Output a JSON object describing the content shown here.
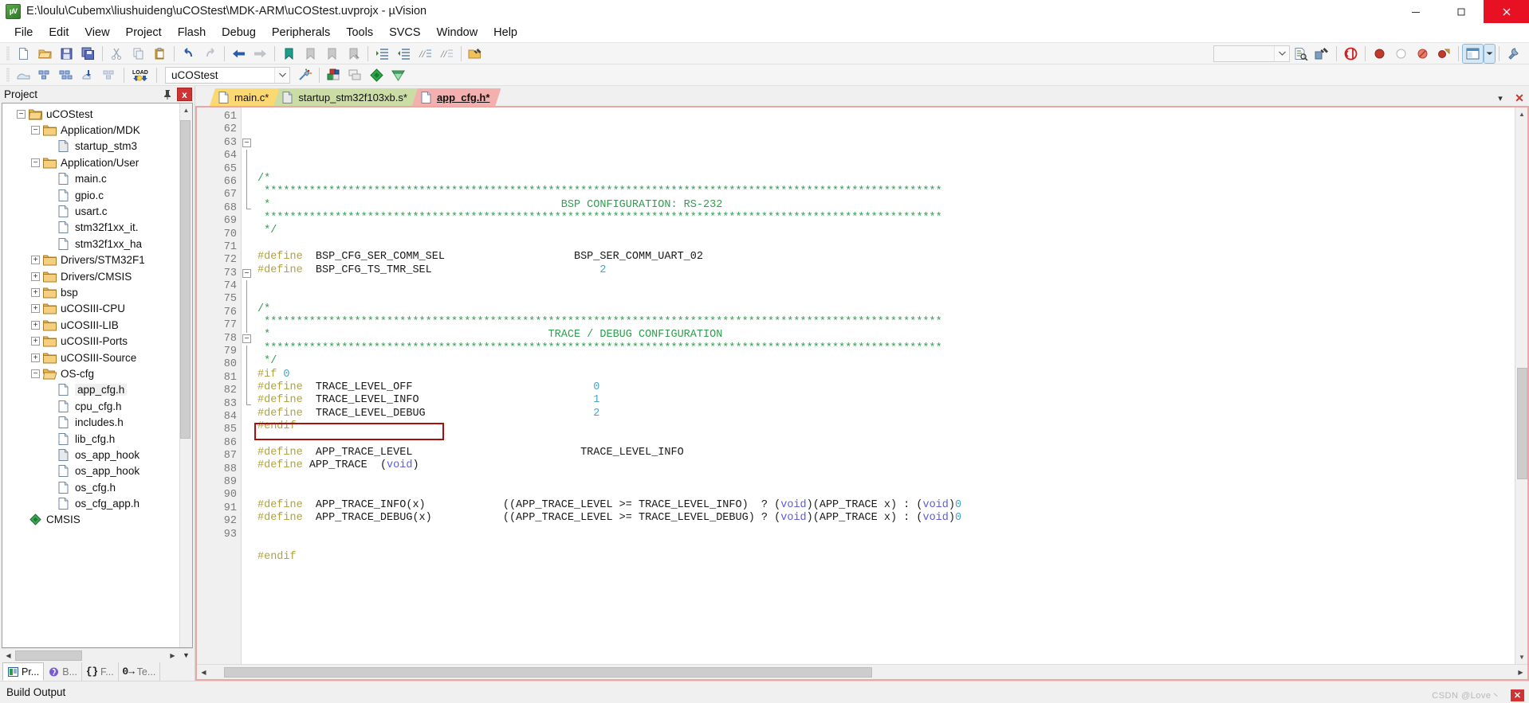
{
  "window": {
    "title": "E:\\loulu\\Cubemx\\liushuideng\\uCOStest\\MDK-ARM\\uCOStest.uvprojx - µVision",
    "icon_text": "µV",
    "minimize_label": "—",
    "maximize_label": "❐",
    "close_label": "✕"
  },
  "menubar": {
    "items": [
      {
        "label": "File"
      },
      {
        "label": "Edit"
      },
      {
        "label": "View"
      },
      {
        "label": "Project"
      },
      {
        "label": "Flash"
      },
      {
        "label": "Debug"
      },
      {
        "label": "Peripherals"
      },
      {
        "label": "Tools"
      },
      {
        "label": "SVCS"
      },
      {
        "label": "Window"
      },
      {
        "label": "Help"
      }
    ]
  },
  "toolbar_main": {
    "buttons": [
      {
        "name": "new-file-icon"
      },
      {
        "name": "open-file-icon"
      },
      {
        "name": "save-icon"
      },
      {
        "name": "save-all-icon"
      },
      {
        "name": "cut-icon"
      },
      {
        "name": "copy-icon"
      },
      {
        "name": "paste-icon"
      },
      {
        "name": "undo-icon"
      },
      {
        "name": "redo-icon"
      },
      {
        "name": "navigate-back-icon"
      },
      {
        "name": "navigate-forward-icon"
      },
      {
        "name": "bookmark-toggle-icon"
      },
      {
        "name": "bookmark-prev-icon"
      },
      {
        "name": "bookmark-next-icon"
      },
      {
        "name": "bookmark-clear-icon"
      },
      {
        "name": "indent-icon"
      },
      {
        "name": "outdent-icon"
      },
      {
        "name": "comment-icon"
      },
      {
        "name": "uncomment-icon"
      },
      {
        "name": "find-in-files-icon"
      }
    ],
    "right_buttons": [
      {
        "name": "search-combo-dropdown-icon"
      },
      {
        "name": "incremental-find-icon"
      },
      {
        "name": "find-next-icon"
      },
      {
        "name": "start-debug-icon"
      },
      {
        "name": "insert-breakpoint-icon"
      },
      {
        "name": "disable-breakpoint-icon"
      },
      {
        "name": "kill-all-breakpoints-icon"
      },
      {
        "name": "disable-all-breakpoints-icon"
      },
      {
        "name": "window-layout-icon"
      },
      {
        "name": "layout-dropdown-icon"
      },
      {
        "name": "configure-icon"
      }
    ]
  },
  "toolbar_build": {
    "buttons": [
      {
        "name": "translate-icon"
      },
      {
        "name": "build-icon"
      },
      {
        "name": "rebuild-icon"
      },
      {
        "name": "batch-build-icon"
      },
      {
        "name": "stop-build-icon"
      },
      {
        "name": "download-icon",
        "label": "LOAD"
      }
    ],
    "project_combo": {
      "value": "uCOStest",
      "dropdown_icon": "chevron-down-icon"
    },
    "right_buttons": [
      {
        "name": "target-options-icon"
      },
      {
        "name": "manage-project-items-icon"
      },
      {
        "name": "manage-run-time-environment-icon"
      },
      {
        "name": "multi-project-icon"
      },
      {
        "name": "pack-installer-icon"
      }
    ]
  },
  "project_pane": {
    "title": "Project",
    "pin_icon": "pin-icon",
    "close_icon": "close-icon",
    "tree": [
      {
        "label": "uCOStest",
        "depth": 0,
        "expander": "minus",
        "icon": "project-folder-icon"
      },
      {
        "label": "Application/MDK",
        "depth": 1,
        "expander": "minus",
        "icon": "folder-icon"
      },
      {
        "label": "startup_stm3",
        "depth": 2,
        "expander": "none",
        "icon": "asm-file-icon"
      },
      {
        "label": "Application/User",
        "depth": 1,
        "expander": "minus",
        "icon": "folder-icon"
      },
      {
        "label": "main.c",
        "depth": 2,
        "expander": "none",
        "icon": "c-file-icon"
      },
      {
        "label": "gpio.c",
        "depth": 2,
        "expander": "none",
        "icon": "c-file-icon"
      },
      {
        "label": "usart.c",
        "depth": 2,
        "expander": "none",
        "icon": "c-file-icon"
      },
      {
        "label": "stm32f1xx_it.",
        "depth": 2,
        "expander": "none",
        "icon": "c-file-icon"
      },
      {
        "label": "stm32f1xx_ha",
        "depth": 2,
        "expander": "none",
        "icon": "c-file-icon"
      },
      {
        "label": "Drivers/STM32F1",
        "depth": 1,
        "expander": "plus",
        "icon": "folder-icon"
      },
      {
        "label": "Drivers/CMSIS",
        "depth": 1,
        "expander": "plus",
        "icon": "folder-icon"
      },
      {
        "label": "bsp",
        "depth": 1,
        "expander": "plus",
        "icon": "folder-icon"
      },
      {
        "label": "uCOSIII-CPU",
        "depth": 1,
        "expander": "plus",
        "icon": "folder-icon"
      },
      {
        "label": "uCOSIII-LIB",
        "depth": 1,
        "expander": "plus",
        "icon": "folder-icon"
      },
      {
        "label": "uCOSIII-Ports",
        "depth": 1,
        "expander": "plus",
        "icon": "folder-icon"
      },
      {
        "label": "uCOSIII-Source",
        "depth": 1,
        "expander": "plus",
        "icon": "folder-icon"
      },
      {
        "label": "OS-cfg",
        "depth": 1,
        "expander": "minus",
        "icon": "folder-open-icon"
      },
      {
        "label": "app_cfg.h",
        "depth": 2,
        "expander": "none",
        "icon": "h-file-icon",
        "selected": true
      },
      {
        "label": "cpu_cfg.h",
        "depth": 2,
        "expander": "none",
        "icon": "h-file-icon"
      },
      {
        "label": "includes.h",
        "depth": 2,
        "expander": "none",
        "icon": "h-file-icon"
      },
      {
        "label": "lib_cfg.h",
        "depth": 2,
        "expander": "none",
        "icon": "h-file-icon"
      },
      {
        "label": "os_app_hook",
        "depth": 2,
        "expander": "none",
        "icon": "c-file-dim-icon"
      },
      {
        "label": "os_app_hook",
        "depth": 2,
        "expander": "none",
        "icon": "h-file-icon"
      },
      {
        "label": "os_cfg.h",
        "depth": 2,
        "expander": "none",
        "icon": "h-file-icon"
      },
      {
        "label": "os_cfg_app.h",
        "depth": 2,
        "expander": "none",
        "icon": "h-file-icon"
      },
      {
        "label": "CMSIS",
        "depth": 0,
        "expander": "none",
        "icon": "cmsis-icon"
      }
    ],
    "tabs": [
      {
        "label": "Pr...",
        "icon": "project-tab-icon",
        "active": true
      },
      {
        "label": "B...",
        "icon": "books-tab-icon",
        "active": false
      },
      {
        "label": "F...",
        "icon": "functions-tab-icon",
        "active": false
      },
      {
        "label": "Te...",
        "icon": "templates-tab-icon",
        "active": false
      }
    ]
  },
  "editor": {
    "tabs": [
      {
        "label": "main.c*",
        "color": "#fbd870",
        "active": false,
        "icon": "c-file-icon"
      },
      {
        "label": "startup_stm32f103xb.s*",
        "color": "#cbdca5",
        "active": false,
        "icon": "asm-file-icon"
      },
      {
        "label": "app_cfg.h*",
        "color": "#f4b0ae",
        "active": true,
        "icon": "h-file-icon"
      }
    ],
    "tabstrip_buttons": [
      {
        "name": "tab-list-dropdown-icon",
        "label": "▾"
      },
      {
        "name": "close-tab-icon",
        "label": "✕"
      }
    ],
    "first_line_number": 61,
    "lines": [
      {
        "n": 61,
        "fold": "none",
        "tokens": []
      },
      {
        "n": 62,
        "fold": "none",
        "tokens": []
      },
      {
        "n": 63,
        "fold": "minus",
        "tokens": [
          {
            "t": "/*",
            "c": "cmt"
          }
        ]
      },
      {
        "n": 64,
        "fold": "bar",
        "tokens": [
          {
            "t": " *********************************************************************************************************",
            "c": "cmt"
          }
        ]
      },
      {
        "n": 65,
        "fold": "bar",
        "tokens": [
          {
            "t": " *                                             BSP CONFIGURATION: RS-232",
            "c": "cmt"
          }
        ]
      },
      {
        "n": 66,
        "fold": "bar",
        "tokens": [
          {
            "t": " *********************************************************************************************************",
            "c": "cmt"
          }
        ]
      },
      {
        "n": 67,
        "fold": "bar",
        "tokens": [
          {
            "t": " */",
            "c": "cmt"
          }
        ]
      },
      {
        "n": 68,
        "fold": "tick",
        "tokens": []
      },
      {
        "n": 69,
        "fold": "none",
        "tokens": [
          {
            "t": "#define",
            "c": "pre"
          },
          {
            "t": "  BSP_CFG_SER_COMM_SEL                    ",
            "c": "id"
          },
          {
            "t": "BSP_SER_COMM_UART_02",
            "c": "id"
          }
        ]
      },
      {
        "n": 70,
        "fold": "none",
        "tokens": [
          {
            "t": "#define",
            "c": "pre"
          },
          {
            "t": "  BSP_CFG_TS_TMR_SEL                          ",
            "c": "id"
          },
          {
            "t": "2",
            "c": "num"
          }
        ]
      },
      {
        "n": 71,
        "fold": "none",
        "tokens": []
      },
      {
        "n": 72,
        "fold": "none",
        "tokens": []
      },
      {
        "n": 73,
        "fold": "minus",
        "tokens": [
          {
            "t": "/*",
            "c": "cmt"
          }
        ]
      },
      {
        "n": 74,
        "fold": "bar",
        "tokens": [
          {
            "t": " *********************************************************************************************************",
            "c": "cmt"
          }
        ]
      },
      {
        "n": 75,
        "fold": "bar",
        "tokens": [
          {
            "t": " *                                           TRACE / DEBUG CONFIGURATION",
            "c": "cmt"
          }
        ]
      },
      {
        "n": 76,
        "fold": "bar",
        "tokens": [
          {
            "t": " *********************************************************************************************************",
            "c": "cmt"
          }
        ]
      },
      {
        "n": 77,
        "fold": "bar",
        "tokens": [
          {
            "t": " */",
            "c": "cmt"
          }
        ]
      },
      {
        "n": 78,
        "fold": "minus",
        "tokens": [
          {
            "t": "#if",
            "c": "pre"
          },
          {
            "t": " ",
            "c": "id"
          },
          {
            "t": "0",
            "c": "num"
          }
        ]
      },
      {
        "n": 79,
        "fold": "bar",
        "tokens": [
          {
            "t": "#define",
            "c": "pre"
          },
          {
            "t": "  TRACE_LEVEL_OFF                            ",
            "c": "id"
          },
          {
            "t": "0",
            "c": "num"
          }
        ]
      },
      {
        "n": 80,
        "fold": "bar",
        "tokens": [
          {
            "t": "#define",
            "c": "pre"
          },
          {
            "t": "  TRACE_LEVEL_INFO                           ",
            "c": "id"
          },
          {
            "t": "1",
            "c": "num"
          }
        ]
      },
      {
        "n": 81,
        "fold": "bar",
        "tokens": [
          {
            "t": "#define",
            "c": "pre"
          },
          {
            "t": "  TRACE_LEVEL_DEBUG                          ",
            "c": "id"
          },
          {
            "t": "2",
            "c": "num"
          }
        ]
      },
      {
        "n": 82,
        "fold": "bar",
        "tokens": [
          {
            "t": "#endif",
            "c": "pre"
          }
        ]
      },
      {
        "n": 83,
        "fold": "tick",
        "tokens": []
      },
      {
        "n": 84,
        "fold": "none",
        "tokens": [
          {
            "t": "#define",
            "c": "pre"
          },
          {
            "t": "  APP_TRACE_LEVEL                          ",
            "c": "id"
          },
          {
            "t": "TRACE_LEVEL_INFO",
            "c": "id"
          }
        ]
      },
      {
        "n": 85,
        "fold": "none",
        "tokens": [
          {
            "t": "#define",
            "c": "pre"
          },
          {
            "t": " APP_TRACE  ",
            "c": "id"
          },
          {
            "t": "(",
            "c": "punct"
          },
          {
            "t": "void",
            "c": "kw"
          },
          {
            "t": ")",
            "c": "punct"
          }
        ]
      },
      {
        "n": 86,
        "fold": "none",
        "tokens": []
      },
      {
        "n": 87,
        "fold": "none",
        "tokens": []
      },
      {
        "n": 88,
        "fold": "none",
        "tokens": [
          {
            "t": "#define",
            "c": "pre"
          },
          {
            "t": "  APP_TRACE_INFO(x)            ((APP_TRACE_LEVEL >= TRACE_LEVEL_INFO)  ? ",
            "c": "id"
          },
          {
            "t": "(",
            "c": "punct"
          },
          {
            "t": "void",
            "c": "kw"
          },
          {
            "t": ")",
            "c": "punct"
          },
          {
            "t": "(APP_TRACE x) : ",
            "c": "id"
          },
          {
            "t": "(",
            "c": "punct"
          },
          {
            "t": "void",
            "c": "kw"
          },
          {
            "t": ")",
            "c": "punct"
          },
          {
            "t": "0",
            "c": "num"
          }
        ]
      },
      {
        "n": 89,
        "fold": "none",
        "tokens": [
          {
            "t": "#define",
            "c": "pre"
          },
          {
            "t": "  APP_TRACE_DEBUG(x)           ((APP_TRACE_LEVEL >= TRACE_LEVEL_DEBUG) ? ",
            "c": "id"
          },
          {
            "t": "(",
            "c": "punct"
          },
          {
            "t": "void",
            "c": "kw"
          },
          {
            "t": ")",
            "c": "punct"
          },
          {
            "t": "(APP_TRACE x) : ",
            "c": "id"
          },
          {
            "t": "(",
            "c": "punct"
          },
          {
            "t": "void",
            "c": "kw"
          },
          {
            "t": ")",
            "c": "punct"
          },
          {
            "t": "0",
            "c": "num"
          }
        ]
      },
      {
        "n": 90,
        "fold": "none",
        "tokens": []
      },
      {
        "n": 91,
        "fold": "none",
        "tokens": []
      },
      {
        "n": 92,
        "fold": "none",
        "tokens": [
          {
            "t": "#endif",
            "c": "pre"
          }
        ]
      },
      {
        "n": 93,
        "fold": "none",
        "tokens": []
      }
    ],
    "highlight": {
      "line": 85,
      "color": "#a81010",
      "label": "annotation-rectangle"
    }
  },
  "status": {
    "build_output_label": "Build Output",
    "watermark": "CSDN @Love丶",
    "close_label": "✕"
  },
  "colors": {
    "comment_green": "#2f9e4f",
    "preproc_olive": "#b0a33c",
    "number_blue": "#4aa3c8",
    "keyword_blue": "#5b5be0",
    "highlight_red": "#a81010",
    "tab_main_c": "#fbd870",
    "tab_startup": "#cbdca5",
    "tab_app_cfg": "#f4b0ae"
  }
}
